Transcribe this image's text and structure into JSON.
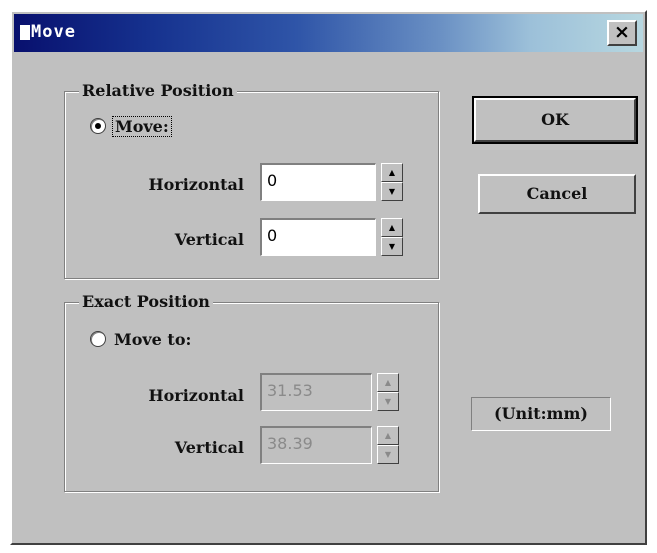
{
  "window": {
    "title": "Move",
    "close_glyph": "×"
  },
  "relative": {
    "legend": "Relative Position",
    "radio_label": "Move:",
    "selected": true,
    "horizontal_label": "Horizontal",
    "horizontal_value": "0",
    "vertical_label": "Vertical",
    "vertical_value": "0"
  },
  "exact": {
    "legend": "Exact Position",
    "radio_label": "Move to:",
    "selected": false,
    "horizontal_label": "Horizontal",
    "horizontal_value": "31.53",
    "vertical_label": "Vertical",
    "vertical_value": "38.39"
  },
  "buttons": {
    "ok": "OK",
    "cancel": "Cancel"
  },
  "unit_label": "(Unit:mm)",
  "spin_glyphs": {
    "up": "▲",
    "down": "▼"
  }
}
